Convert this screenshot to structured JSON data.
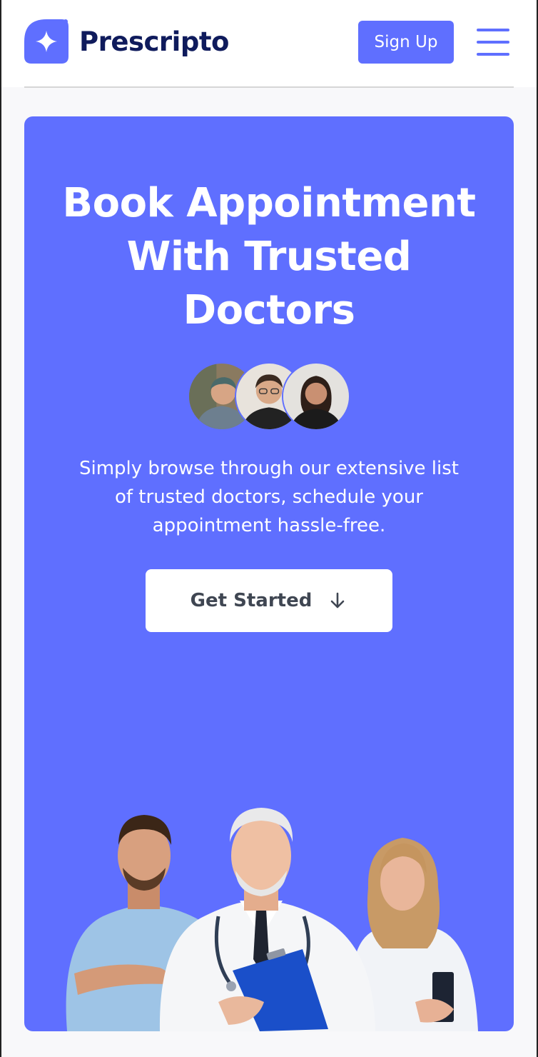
{
  "header": {
    "brand_name": "Prescripto",
    "logo_icon": "prescripto-logo-icon",
    "signup_label": "Sign Up",
    "menu_icon": "hamburger-menu-icon"
  },
  "hero": {
    "title_line1": "Book Appointment",
    "title_line2": "With Trusted",
    "title_line3": "Doctors",
    "subtitle_line1": "Simply browse through our extensive list",
    "subtitle_line2": "of trusted doctors, schedule your",
    "subtitle_line3": "appointment hassle-free.",
    "cta_label": "Get Started",
    "cta_icon": "arrow-down-icon",
    "avatars": [
      "doctor-avatar-1",
      "doctor-avatar-2",
      "doctor-avatar-3"
    ],
    "illustration": "group-of-doctors-image"
  },
  "colors": {
    "primary": "#5F6FFF",
    "brand_text": "#0F1B5C",
    "background": "#FFFFFF"
  }
}
